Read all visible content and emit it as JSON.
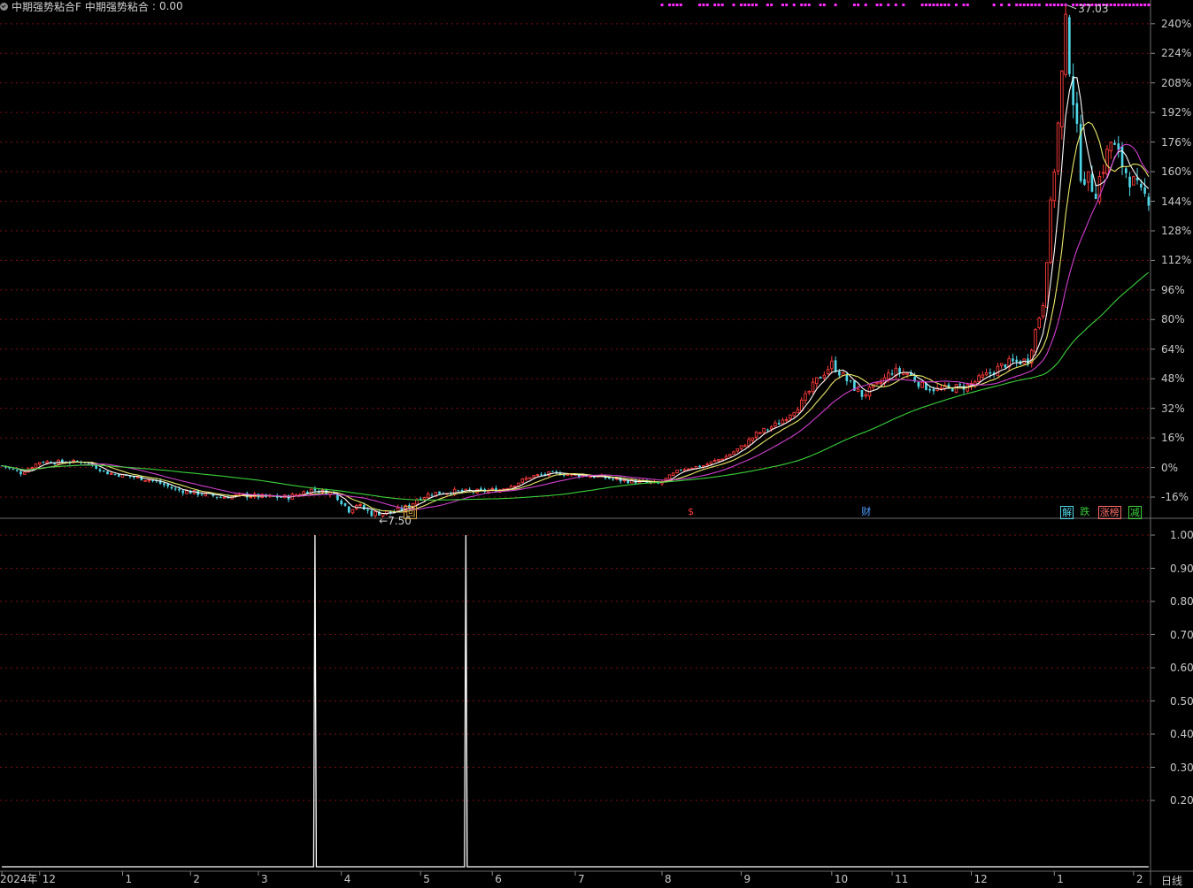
{
  "chart_data": [
    {
      "type": "candlestick",
      "y_scale": "percent",
      "ylim": [
        -27,
        249
      ],
      "y_ticks": [
        "240%",
        "224%",
        "208%",
        "192%",
        "176%",
        "160%",
        "144%",
        "128%",
        "112%",
        "96%",
        "80%",
        "64%",
        "48%",
        "32%",
        "16%",
        "0%",
        "-16%"
      ],
      "y_tick_values": [
        240,
        224,
        208,
        192,
        176,
        160,
        144,
        128,
        112,
        96,
        80,
        64,
        48,
        32,
        16,
        0,
        -16
      ],
      "x_ticks": [
        "2024年",
        "12",
        "1",
        "2",
        "3",
        "4",
        "5",
        "6",
        "7",
        "8",
        "9",
        "10",
        "11",
        "12",
        "1",
        "2"
      ],
      "x_tick_positions": [
        0,
        10,
        32,
        50,
        68,
        90,
        111,
        130,
        152,
        175,
        196,
        220,
        236,
        257,
        279,
        300
      ],
      "n_bars": 305,
      "high_label": "37.03",
      "low_label": "7.50",
      "close_path": [
        [
          0,
          1
        ],
        [
          5,
          -3
        ],
        [
          10,
          3
        ],
        [
          16,
          3
        ],
        [
          22,
          3
        ],
        [
          28,
          -3
        ],
        [
          34,
          -5
        ],
        [
          40,
          -7
        ],
        [
          46,
          -12
        ],
        [
          52,
          -14
        ],
        [
          58,
          -16
        ],
        [
          64,
          -15
        ],
        [
          70,
          -16
        ],
        [
          76,
          -16
        ],
        [
          82,
          -12
        ],
        [
          88,
          -14
        ],
        [
          92,
          -23
        ],
        [
          94,
          -20
        ],
        [
          98,
          -25
        ],
        [
          104,
          -24
        ],
        [
          108,
          -21
        ],
        [
          110,
          -17
        ],
        [
          114,
          -14
        ],
        [
          120,
          -13
        ],
        [
          126,
          -13
        ],
        [
          132,
          -12
        ],
        [
          136,
          -9
        ],
        [
          140,
          -5
        ],
        [
          146,
          -3
        ],
        [
          152,
          -4
        ],
        [
          158,
          -5
        ],
        [
          164,
          -7
        ],
        [
          170,
          -8
        ],
        [
          174,
          -9
        ],
        [
          180,
          -1
        ],
        [
          186,
          1
        ],
        [
          192,
          6
        ],
        [
          196,
          11
        ],
        [
          200,
          18
        ],
        [
          206,
          24
        ],
        [
          212,
          35
        ],
        [
          216,
          47
        ],
        [
          220,
          56
        ],
        [
          224,
          47
        ],
        [
          228,
          39
        ],
        [
          232,
          44
        ],
        [
          236,
          52
        ],
        [
          240,
          51
        ],
        [
          244,
          44
        ],
        [
          248,
          42
        ],
        [
          252,
          43
        ],
        [
          256,
          44
        ],
        [
          262,
          51
        ],
        [
          266,
          56
        ],
        [
          272,
          58
        ],
        [
          276,
          90
        ],
        [
          278,
          140
        ],
        [
          280,
          185
        ],
        [
          282,
          238
        ],
        [
          284,
          200
        ],
        [
          286,
          160
        ],
        [
          290,
          150
        ],
        [
          294,
          176
        ],
        [
          298,
          160
        ],
        [
          302,
          147
        ],
        [
          304,
          146
        ]
      ],
      "ma_lines": [
        {
          "color": "#ffffff",
          "window": 5
        },
        {
          "color": "#e8e86a",
          "window": 10
        },
        {
          "color": "#d040d0",
          "window": 20
        },
        {
          "color": "#3ad13a",
          "window": 60
        }
      ],
      "colors": {
        "up": "#ff3b3b",
        "down": "#4fd6e6",
        "background": "#000000",
        "grid": "#7a1010",
        "axis_text": "#c8c8c8"
      },
      "signal_dots": {
        "color": "#ff2cff",
        "label": ""
      },
      "event_markers": [
        {
          "text": "回",
          "bar": 108,
          "color": "#d6a33a",
          "box": true
        },
        {
          "text": "$",
          "bar": 183,
          "color": "#ff3b3b",
          "box": false
        },
        {
          "text": "财",
          "bar": 229,
          "color": "#4ea0ff",
          "box": false
        },
        {
          "text": "解",
          "bar": 282,
          "color": "#4fd6e6",
          "box": true
        },
        {
          "text": "跌",
          "bar": 287,
          "color": "#3ad13a",
          "box": false
        },
        {
          "text": "涨榜",
          "bar": 292,
          "color": "#ff6b6b",
          "box": true
        },
        {
          "text": "减",
          "bar": 300,
          "color": "#3ad13a",
          "box": true
        }
      ]
    },
    {
      "type": "line",
      "title": "中期强势粘合F",
      "series": [
        {
          "name": "中期强势粘合",
          "current": "0.00",
          "color": "#ffffff"
        }
      ],
      "ylim": [
        0,
        1.0
      ],
      "y_ticks": [
        "1.00",
        "0.90",
        "0.80",
        "0.70",
        "0.60",
        "0.50",
        "0.40",
        "0.30",
        "0.20"
      ],
      "y_tick_values": [
        1.0,
        0.9,
        0.8,
        0.7,
        0.6,
        0.5,
        0.4,
        0.3,
        0.2
      ],
      "spikes": [
        {
          "bar": 83,
          "value": 1.0
        },
        {
          "bar": 123,
          "value": 1.0
        }
      ],
      "period_label": "日线"
    }
  ]
}
